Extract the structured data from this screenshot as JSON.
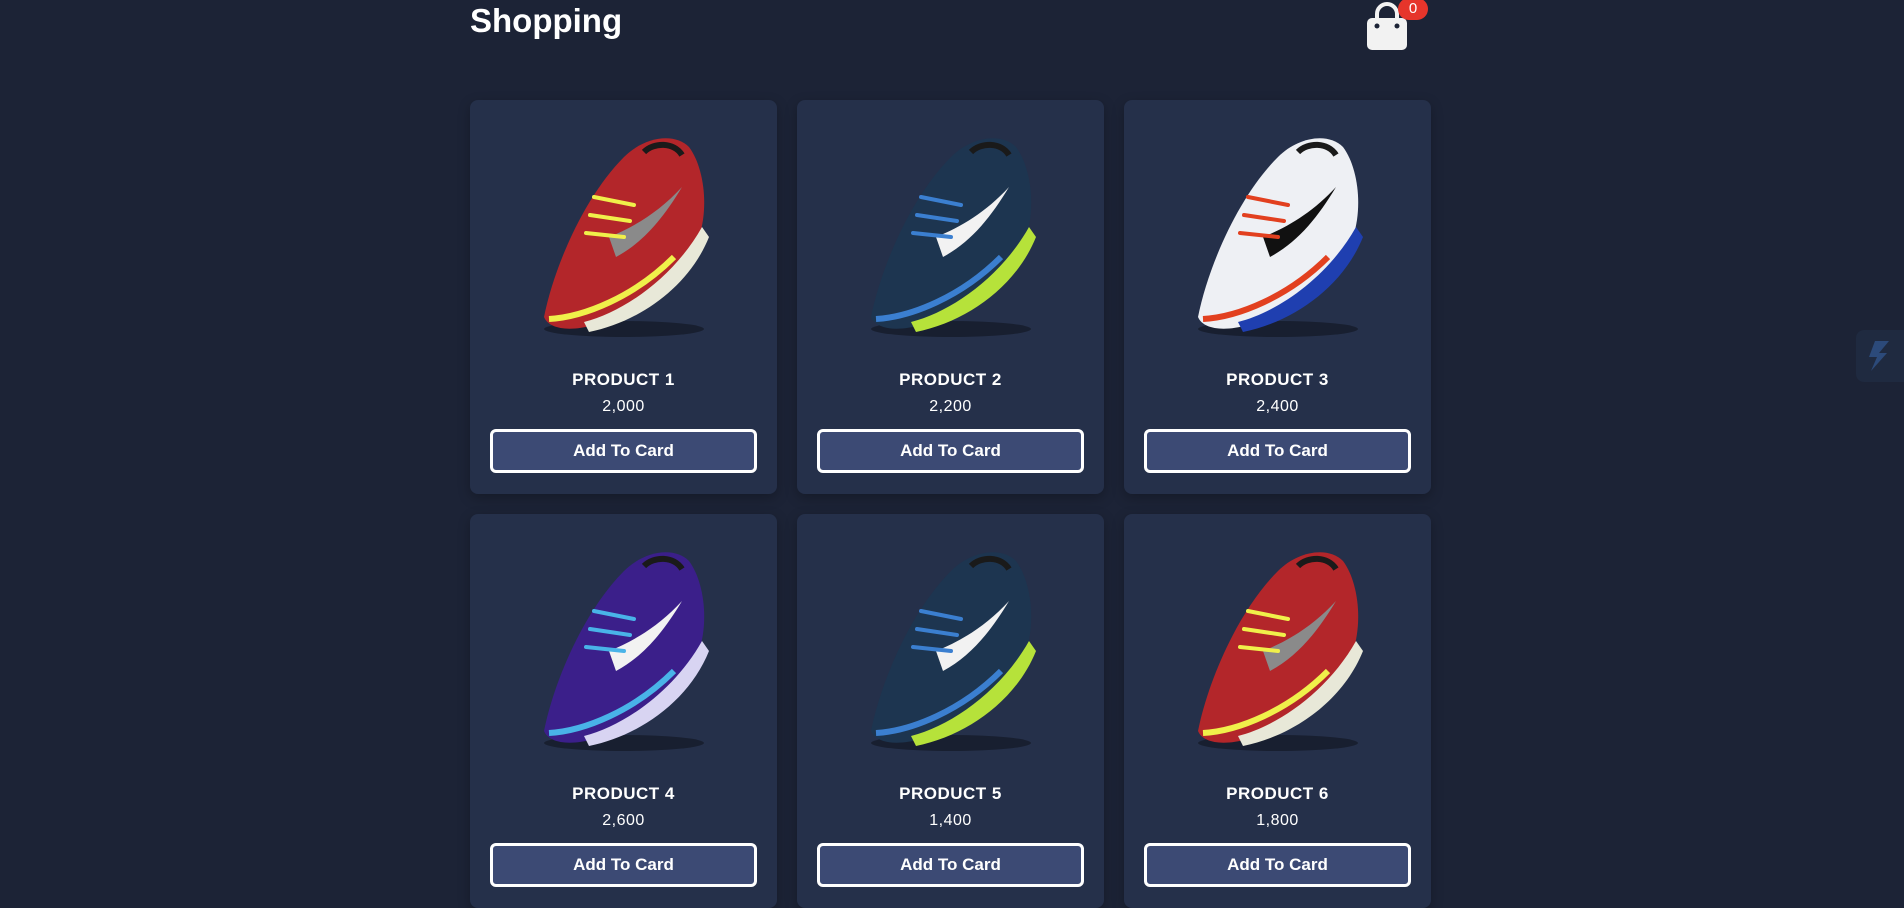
{
  "header": {
    "title": "Shopping",
    "cart_count": "0"
  },
  "products": [
    {
      "name": "PRODUCT 1",
      "price": "2,000",
      "button": "Add To Card",
      "shoe": {
        "upper": "#b3262a",
        "accent": "#f0f04a",
        "sole": "#e8e8d8",
        "swoosh": "#8a8a8a"
      }
    },
    {
      "name": "PRODUCT 2",
      "price": "2,200",
      "button": "Add To Card",
      "shoe": {
        "upper": "#1d3550",
        "accent": "#3b7fd0",
        "sole": "#b6e23a",
        "swoosh": "#f2f2f2"
      }
    },
    {
      "name": "PRODUCT 3",
      "price": "2,400",
      "button": "Add To Card",
      "shoe": {
        "upper": "#eef0f4",
        "accent": "#e2401f",
        "sole": "#1f3fb0",
        "swoosh": "#111111"
      }
    },
    {
      "name": "PRODUCT 4",
      "price": "2,600",
      "button": "Add To Card",
      "shoe": {
        "upper": "#3b1f8a",
        "accent": "#49b3e8",
        "sole": "#d8d4f2",
        "swoosh": "#f2f2f2"
      }
    },
    {
      "name": "PRODUCT 5",
      "price": "1,400",
      "button": "Add To Card",
      "shoe": {
        "upper": "#1d3550",
        "accent": "#3b7fd0",
        "sole": "#b6e23a",
        "swoosh": "#f2f2f2"
      }
    },
    {
      "name": "PRODUCT 6",
      "price": "1,800",
      "button": "Add To Card",
      "shoe": {
        "upper": "#b3262a",
        "accent": "#f0f04a",
        "sole": "#e8e8d8",
        "swoosh": "#8a8a8a"
      }
    }
  ],
  "icons": {
    "cart": "shopping-bag-icon",
    "side_widget": "lightning-icon"
  },
  "colors": {
    "background": "#1c2336",
    "card": "#25304a",
    "button": "#3c4a74",
    "badge": "#e6352b"
  }
}
